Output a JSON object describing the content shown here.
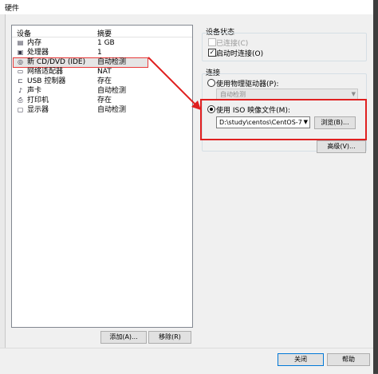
{
  "window": {
    "title": "硬件"
  },
  "device_list": {
    "headers": {
      "device": "设备",
      "summary": "摘要"
    },
    "rows": [
      {
        "icon": "memory-icon",
        "name": "内存",
        "summary": "1 GB"
      },
      {
        "icon": "cpu-icon",
        "name": "处理器",
        "summary": "1"
      },
      {
        "icon": "cd-dvd-icon",
        "name": "新 CD/DVD (IDE)",
        "summary": "自动检测",
        "selected": true
      },
      {
        "icon": "network-adapter-icon",
        "name": "网络适配器",
        "summary": "NAT"
      },
      {
        "icon": "usb-icon",
        "name": "USB 控制器",
        "summary": "存在"
      },
      {
        "icon": "sound-card-icon",
        "name": "声卡",
        "summary": "自动检测"
      },
      {
        "icon": "printer-icon",
        "name": "打印机",
        "summary": "存在"
      },
      {
        "icon": "display-icon",
        "name": "显示器",
        "summary": "自动检测"
      }
    ],
    "add_button": "添加(A)...",
    "remove_button": "移除(R)"
  },
  "device_status": {
    "title": "设备状态",
    "connected": {
      "label": "已连接(C)",
      "checked": false,
      "disabled": true
    },
    "connect_at_power_on": {
      "label": "启动时连接(O)",
      "checked": true
    }
  },
  "connection": {
    "title": "连接",
    "physical_drive": {
      "label": "使用物理驱动器(P):",
      "selected": false
    },
    "physical_drive_value": "自动检测",
    "iso": {
      "label": "使用 ISO 映像文件(M):",
      "selected": true
    },
    "iso_path": "D:\\study\\centos\\CentOS-7-:",
    "browse_button": "浏览(B)...",
    "advanced_button": "高级(V)..."
  },
  "footer": {
    "close_button": "关闭",
    "help_button": "帮助"
  },
  "colors": {
    "highlight_red": "#e02020",
    "accent_blue": "#0078d7"
  }
}
